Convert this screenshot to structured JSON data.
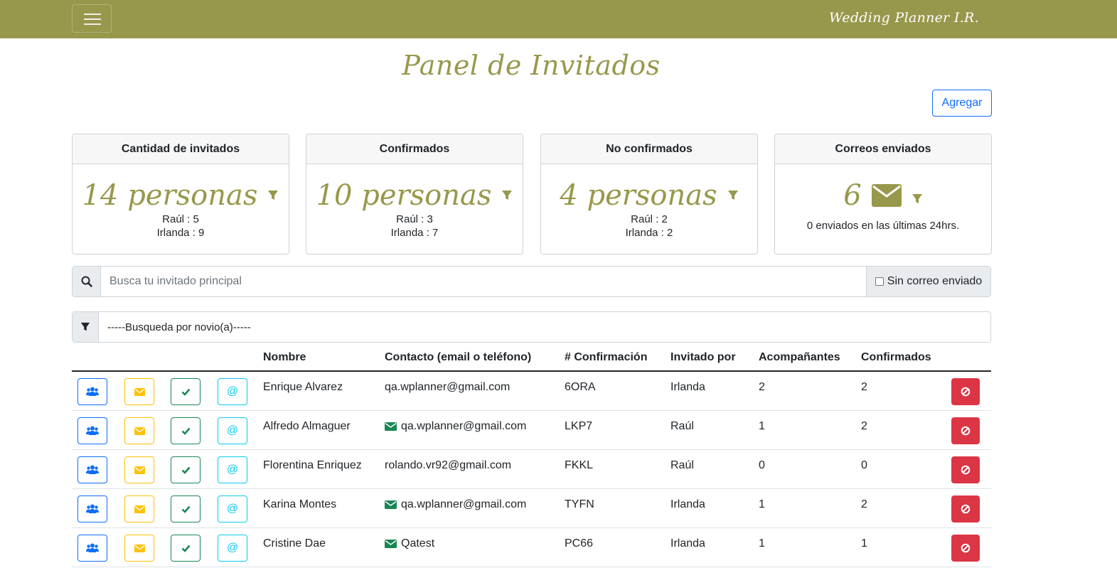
{
  "navbar": {
    "brand": "Wedding Planner I.R.",
    "menu_icon": "hamburger-icon"
  },
  "page": {
    "title": "Panel de Invitados",
    "add_label": "Agregar"
  },
  "colors": {
    "brand": "#98984c",
    "primary": "#0d6efd",
    "warning": "#ffc107",
    "success": "#198754",
    "info": "#0dcaf0",
    "danger": "#dc3545"
  },
  "cards": {
    "total": {
      "header": "Cantidad de invitados",
      "value": "14 personas",
      "line1": "Raúl : 5",
      "line2": "Irlanda : 9"
    },
    "confirmed": {
      "header": "Confirmados",
      "value": "10 personas",
      "line1": "Raúl : 3",
      "line2": "Irlanda : 7"
    },
    "unconfirmed": {
      "header": "No confirmados",
      "value": "4 personas",
      "line1": "Raúl : 2",
      "line2": "Irlanda : 2"
    },
    "emails": {
      "header": "Correos enviados",
      "value": "6",
      "note": "0 enviados en las últimas 24hrs."
    }
  },
  "search": {
    "placeholder": "Busca tu invitado principal",
    "checkbox_label": "Sin correo enviado"
  },
  "filter": {
    "selected": "-----Busqueda por novio(a)-----"
  },
  "table": {
    "headers": [
      "Nombre",
      "Contacto (email o teléfono)",
      "# Confirmación",
      "Invitado por",
      "Acompañantes",
      "Confirmados"
    ],
    "rows": [
      {
        "name": "Enrique Alvarez",
        "contact": "qa.wplanner@gmail.com",
        "mail_sent": false,
        "code": "6ORA",
        "invited_by": "Irlanda",
        "companions": "2",
        "confirmed": "2"
      },
      {
        "name": "Alfredo Almaguer",
        "contact": "qa.wplanner@gmail.com",
        "mail_sent": true,
        "code": "LKP7",
        "invited_by": "Raúl",
        "companions": "1",
        "confirmed": "2"
      },
      {
        "name": "Florentina Enriquez",
        "contact": "rolando.vr92@gmail.com",
        "mail_sent": false,
        "code": "FKKL",
        "invited_by": "Raúl",
        "companions": "0",
        "confirmed": "0"
      },
      {
        "name": "Karina Montes",
        "contact": "qa.wplanner@gmail.com",
        "mail_sent": true,
        "code": "TYFN",
        "invited_by": "Irlanda",
        "companions": "1",
        "confirmed": "2"
      },
      {
        "name": "Cristine Dae",
        "contact": "Qatest",
        "mail_sent": true,
        "code": "PC66",
        "invited_by": "Irlanda",
        "companions": "1",
        "confirmed": "1"
      }
    ],
    "action_icons": [
      "users-icon",
      "envelope-icon",
      "check-icon",
      "at-icon"
    ],
    "at_symbol": "@",
    "delete_icon": "ban-icon"
  }
}
